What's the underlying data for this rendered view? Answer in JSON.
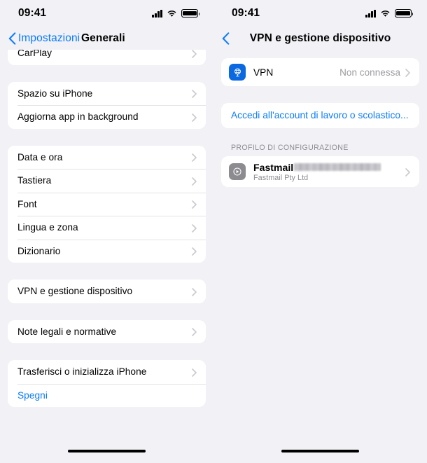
{
  "theme": {
    "accent": "#0a7bff",
    "background": "#f1f1f6",
    "card": "#ffffff",
    "separator": "#e3e3e8",
    "secondary_text": "#8d8d93",
    "vpn_icon_bg": "#0a68e0",
    "profile_icon_bg": "#8b8b90"
  },
  "left_screen": {
    "status_bar": {
      "time": "09:41",
      "cellular_icon": "signal-bars-icon",
      "wifi_icon": "wifi-icon",
      "battery_icon": "battery-full-icon"
    },
    "nav": {
      "back_label": "Impostazioni",
      "back_icon": "chevron-left-icon",
      "title": "Generali"
    },
    "groups": [
      {
        "clipped": true,
        "rows": [
          {
            "label": "CarPlay",
            "accessory": "chevron-right-icon"
          }
        ]
      },
      {
        "clipped": false,
        "rows": [
          {
            "label": "Spazio su iPhone",
            "accessory": "chevron-right-icon"
          },
          {
            "label": "Aggiorna app in background",
            "accessory": "chevron-right-icon"
          }
        ]
      },
      {
        "clipped": false,
        "rows": [
          {
            "label": "Data e ora",
            "accessory": "chevron-right-icon"
          },
          {
            "label": "Tastiera",
            "accessory": "chevron-right-icon"
          },
          {
            "label": "Font",
            "accessory": "chevron-right-icon"
          },
          {
            "label": "Lingua e zona",
            "accessory": "chevron-right-icon"
          },
          {
            "label": "Dizionario",
            "accessory": "chevron-right-icon"
          }
        ]
      },
      {
        "clipped": false,
        "rows": [
          {
            "label": "VPN e gestione dispositivo",
            "accessory": "chevron-right-icon"
          }
        ]
      },
      {
        "clipped": false,
        "rows": [
          {
            "label": "Note legali e normative",
            "accessory": "chevron-right-icon"
          }
        ]
      },
      {
        "clipped": false,
        "rows": [
          {
            "label": "Trasferisci o inizializza iPhone",
            "accessory": "chevron-right-icon"
          },
          {
            "label": "Spegni",
            "accessory": "none",
            "style": "link"
          }
        ]
      }
    ],
    "home_indicator": "home-indicator"
  },
  "right_screen": {
    "status_bar": {
      "time": "09:41",
      "cellular_icon": "signal-bars-icon",
      "wifi_icon": "wifi-icon",
      "battery_icon": "battery-full-icon"
    },
    "nav": {
      "back_label": "",
      "back_icon": "chevron-left-icon",
      "title": "VPN e gestione dispositivo"
    },
    "vpn_row": {
      "icon": "vpn-globe-icon",
      "label": "VPN",
      "value": "Non connessa",
      "accessory": "chevron-right-icon"
    },
    "work_account_link": "Accedi all'account di lavoro o scolastico...",
    "profile_section": {
      "header": "PROFILO DI CONFIGURAZIONE",
      "item": {
        "icon": "profile-gear-icon",
        "title": "Fastmail",
        "title_redacted": true,
        "subtitle": "Fastmail Pty Ltd",
        "accessory": "chevron-right-icon"
      }
    },
    "home_indicator": "home-indicator"
  }
}
